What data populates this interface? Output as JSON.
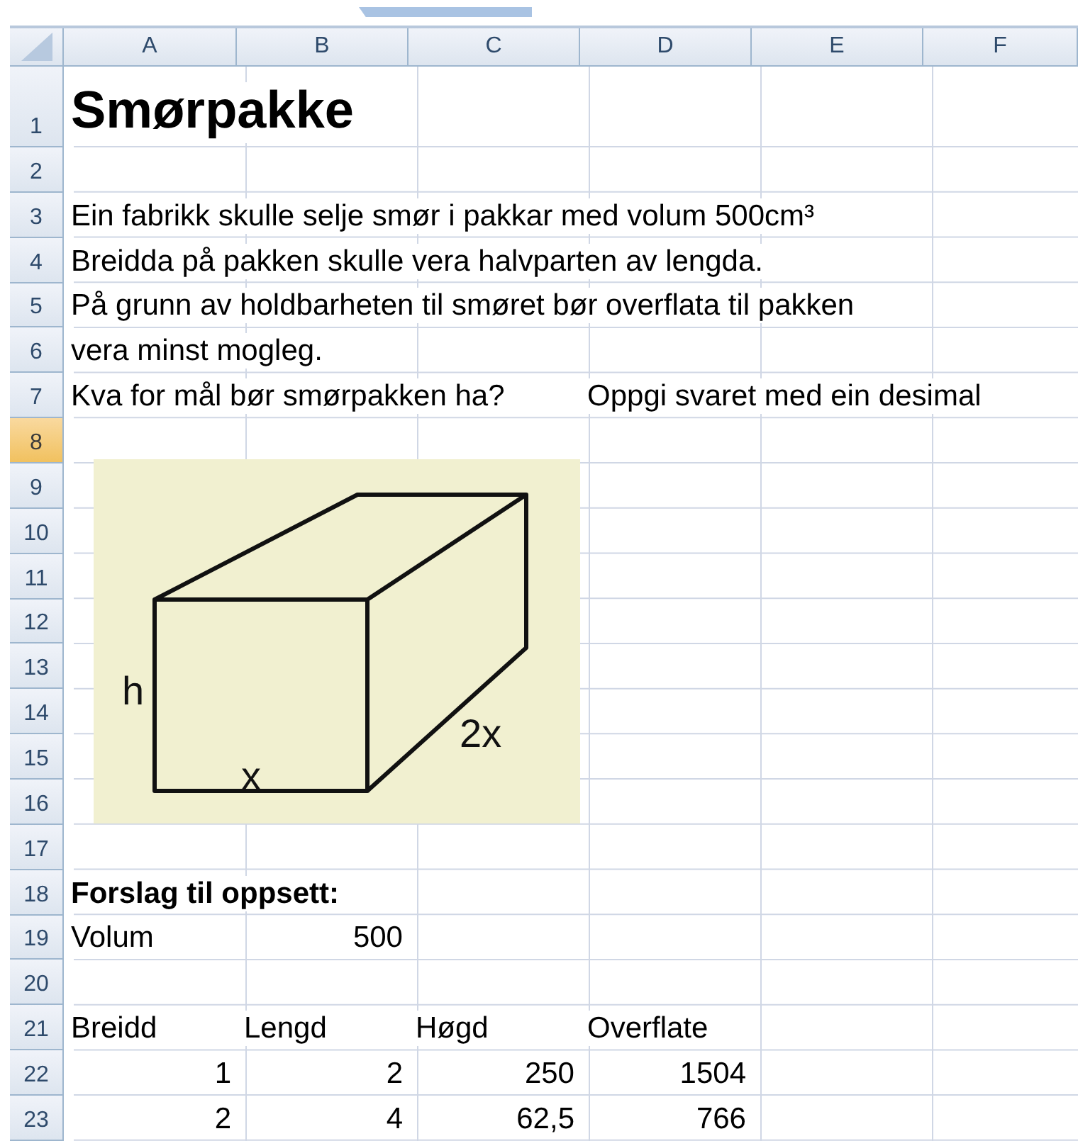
{
  "columns": [
    "A",
    "B",
    "C",
    "D",
    "E",
    "F"
  ],
  "rows": [
    {
      "header": "1",
      "selected": false,
      "cells": {
        "a": {
          "kind": "title",
          "text": "Smørpakke"
        }
      }
    },
    {
      "header": "2",
      "selected": false,
      "cells": {}
    },
    {
      "header": "3",
      "selected": false,
      "cells": {
        "a": {
          "kind": "text",
          "text": "Ein fabrikk skulle selje smør i pakkar med volum 500cm³"
        }
      }
    },
    {
      "header": "4",
      "selected": false,
      "cells": {
        "a": {
          "kind": "text",
          "text": "Breidda på pakken skulle vera halvparten av lengda."
        }
      }
    },
    {
      "header": "5",
      "selected": false,
      "cells": {
        "a": {
          "kind": "text",
          "text": "På grunn av holdbarheten til smøret bør overflata til pakken"
        }
      }
    },
    {
      "header": "6",
      "selected": false,
      "cells": {
        "a": {
          "kind": "text",
          "text": "vera minst mogleg."
        }
      }
    },
    {
      "header": "7",
      "selected": false,
      "cells": {
        "a": {
          "kind": "text",
          "text": "Kva for mål bør smørpakken ha?"
        },
        "d": {
          "kind": "text",
          "text": "Oppgi svaret med ein desimal"
        }
      }
    },
    {
      "header": "8",
      "selected": true,
      "cells": {}
    },
    {
      "header": "9",
      "selected": false,
      "cells": {}
    },
    {
      "header": "10",
      "selected": false,
      "cells": {}
    },
    {
      "header": "11",
      "selected": false,
      "cells": {}
    },
    {
      "header": "12",
      "selected": false,
      "cells": {}
    },
    {
      "header": "13",
      "selected": false,
      "cells": {}
    },
    {
      "header": "14",
      "selected": false,
      "cells": {}
    },
    {
      "header": "15",
      "selected": false,
      "cells": {}
    },
    {
      "header": "16",
      "selected": false,
      "cells": {}
    },
    {
      "header": "17",
      "selected": false,
      "cells": {}
    },
    {
      "header": "18",
      "selected": false,
      "cells": {
        "a": {
          "kind": "bold",
          "text": "Forslag til oppsett:"
        }
      }
    },
    {
      "header": "19",
      "selected": false,
      "cells": {
        "a": {
          "kind": "text",
          "text": "Volum"
        },
        "b": {
          "kind": "number",
          "text": "500"
        }
      }
    },
    {
      "header": "20",
      "selected": false,
      "cells": {}
    },
    {
      "header": "21",
      "selected": false,
      "cells": {
        "a": {
          "kind": "text",
          "text": "Breidd"
        },
        "b": {
          "kind": "text",
          "text": "Lengd"
        },
        "c": {
          "kind": "text",
          "text": "Høgd"
        },
        "d": {
          "kind": "text",
          "text": "Overflate"
        }
      }
    },
    {
      "header": "22",
      "selected": false,
      "cells": {
        "a": {
          "kind": "number",
          "text": "1"
        },
        "b": {
          "kind": "number",
          "text": "2"
        },
        "c": {
          "kind": "number",
          "text": "250"
        },
        "d": {
          "kind": "number",
          "text": "1504"
        }
      }
    },
    {
      "header": "23",
      "selected": false,
      "cells": {
        "a": {
          "kind": "number",
          "text": "2"
        },
        "b": {
          "kind": "number",
          "text": "4"
        },
        "c": {
          "kind": "number",
          "text": "62,5"
        },
        "d": {
          "kind": "number",
          "text": "766"
        }
      }
    }
  ],
  "figure": {
    "height_label": "h",
    "width_label": "x",
    "length_label": "2x"
  }
}
